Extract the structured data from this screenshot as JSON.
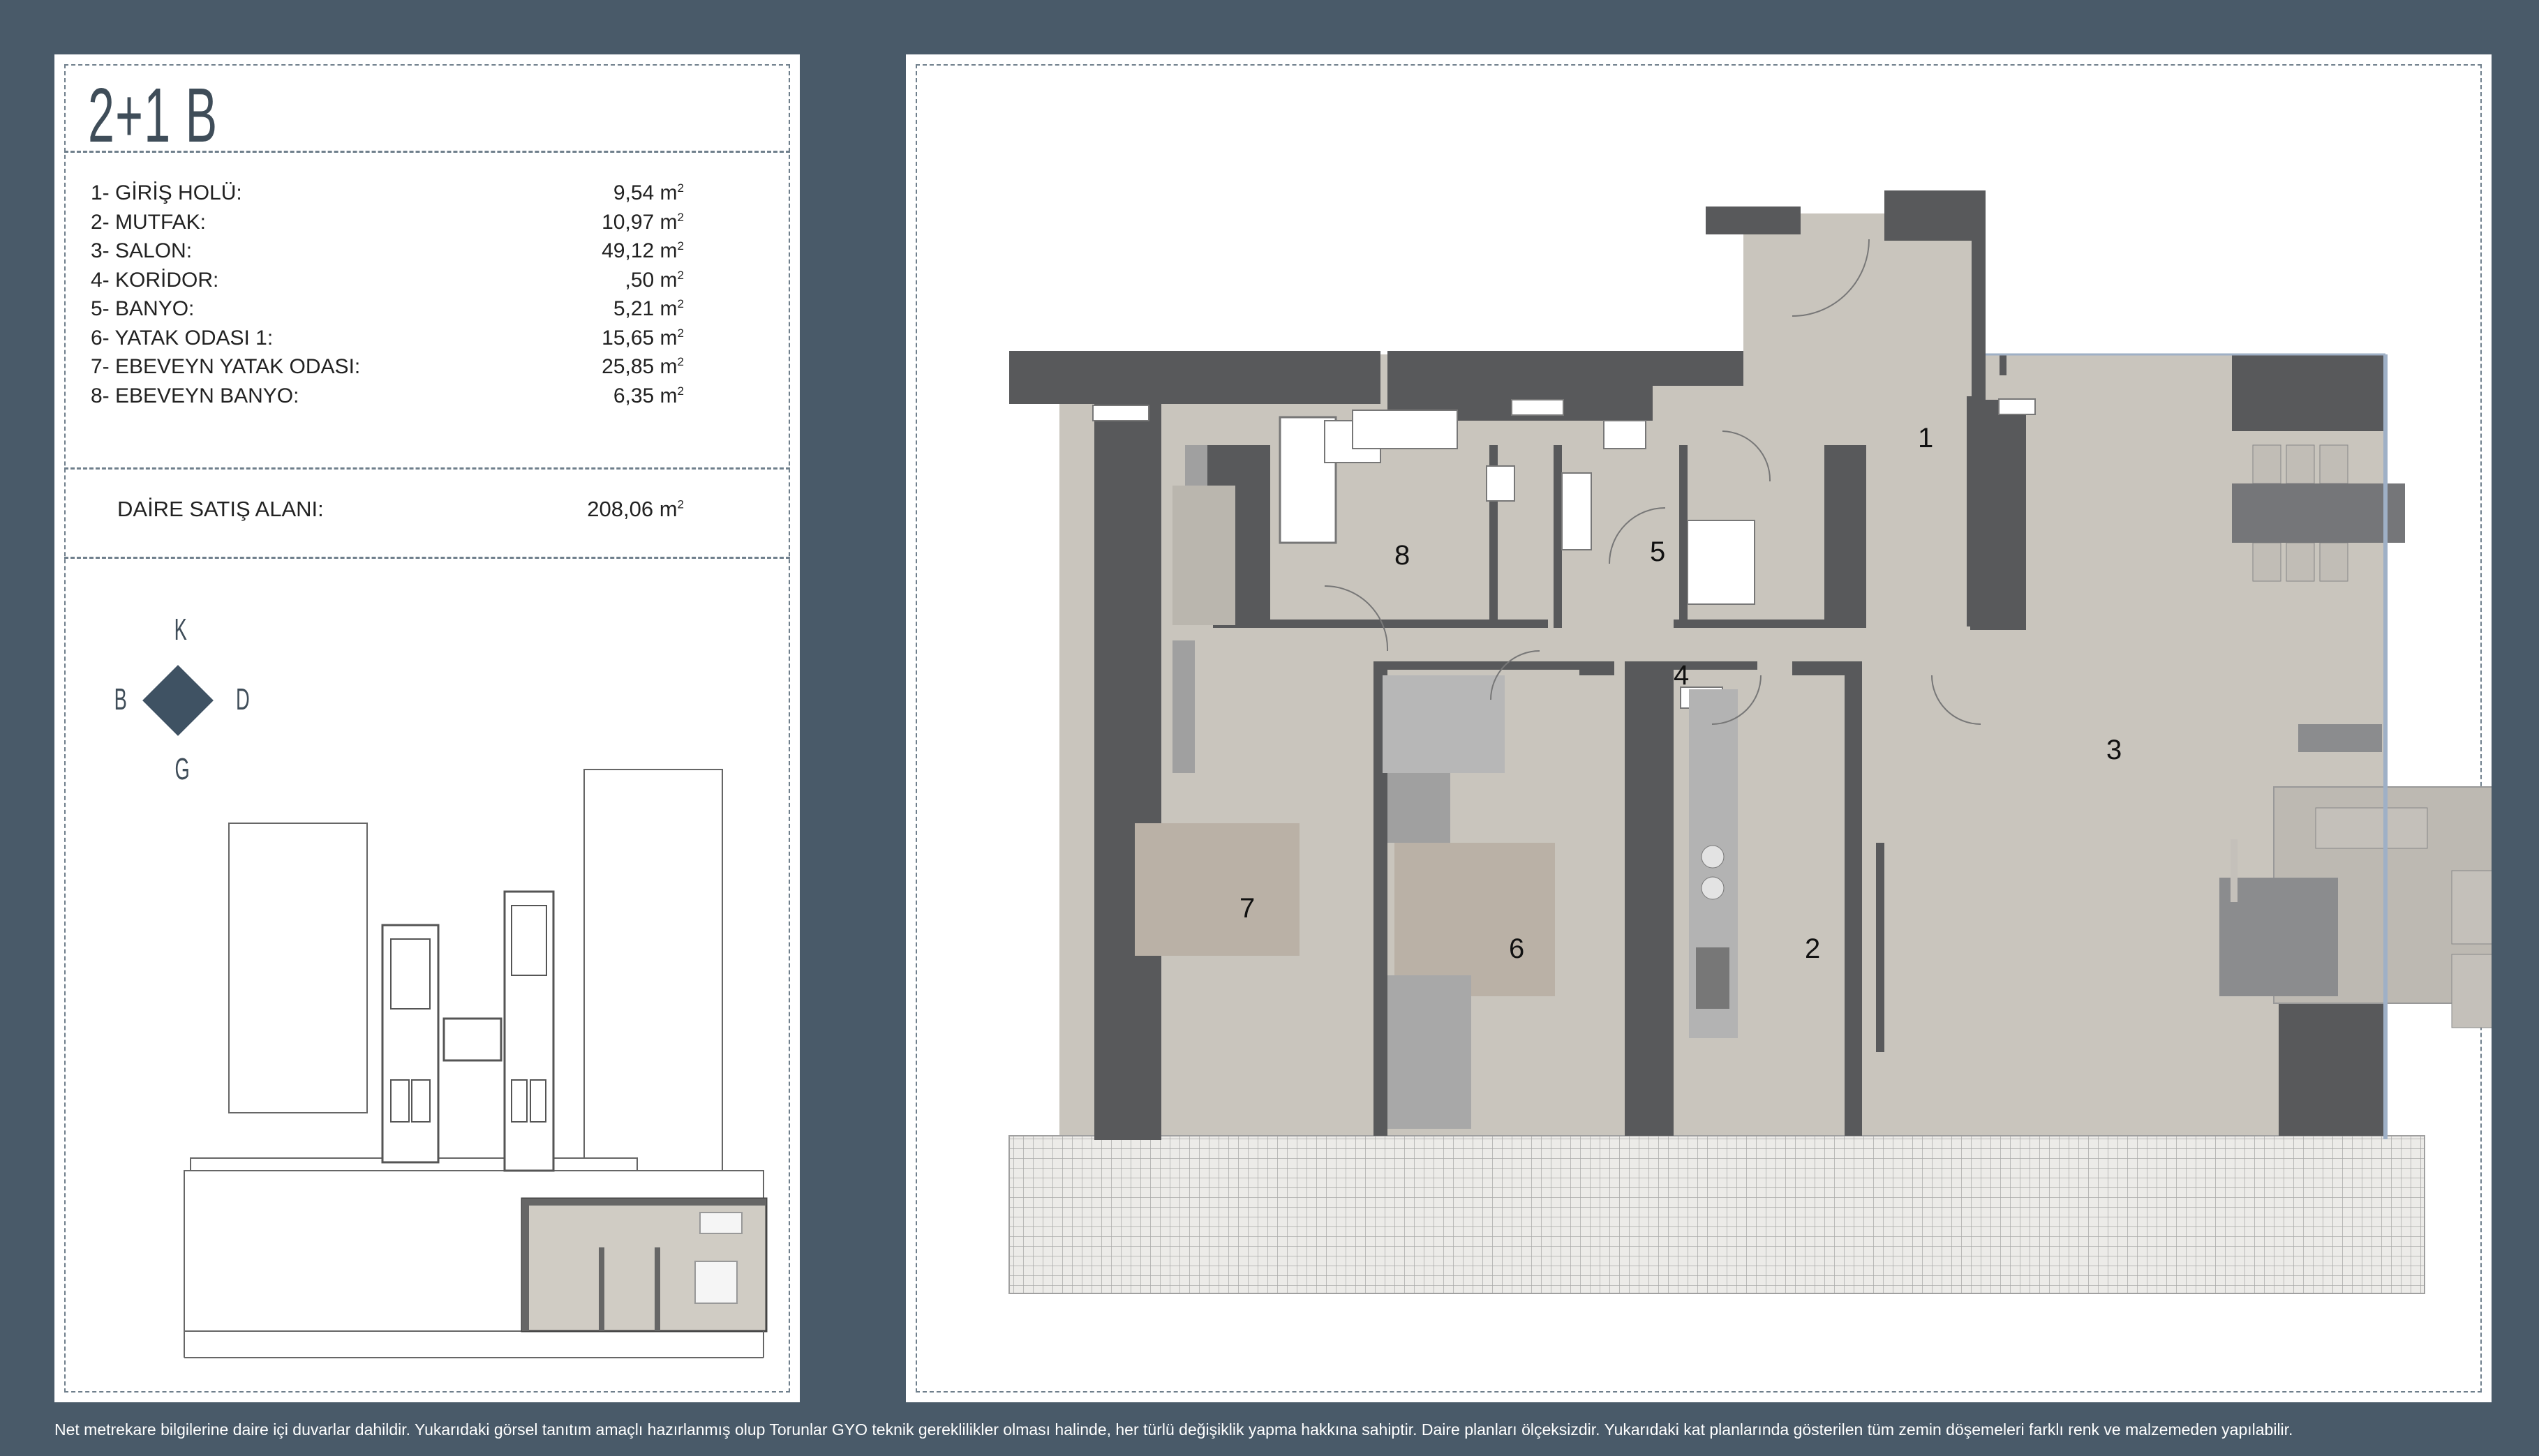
{
  "title": "2+1 B",
  "rooms": [
    {
      "label": "1- GİRİŞ HOLÜ:",
      "area": "9,54 m",
      "unit": "2"
    },
    {
      "label": "2- MUTFAK:",
      "area": "10,97 m",
      "unit": "2"
    },
    {
      "label": "3- SALON:",
      "area": "49,12 m",
      "unit": "2"
    },
    {
      "label": "4- KORİDOR:",
      "area": ",50 m",
      "unit": "2"
    },
    {
      "label": "5- BANYO:",
      "area": "5,21 m",
      "unit": "2"
    },
    {
      "label": "6- YATAK ODASI 1:",
      "area": "15,65 m",
      "unit": "2"
    },
    {
      "label": "7- EBEVEYN YATAK ODASI:",
      "area": "25,85 m",
      "unit": "2"
    },
    {
      "label": "8- EBEVEYN BANYO:",
      "area": "6,35 m",
      "unit": "2"
    }
  ],
  "total": {
    "label": "DAİRE SATIŞ ALANI:",
    "area": "208,06 m",
    "unit": "2"
  },
  "compass": {
    "north": "K",
    "west": "B",
    "east": "D",
    "south": "G"
  },
  "plan_labels": {
    "r1": "1",
    "r2": "2",
    "r3": "3",
    "r4": "4",
    "r5": "5",
    "r6": "6",
    "r7": "7",
    "r8": "8"
  },
  "footnote": "Net metrekare bilgilerine daire içi duvarlar dahildir.  Yukarıdaki görsel tanıtım amaçlı hazırlanmış olup Torunlar GYO teknik gereklilikler olması halinde, her türlü değişiklik yapma hakkına sahiptir. Daire planları ölçeksizdir. Yukarıdaki kat planlarında gösterilen tüm zemin döşemeleri farklı renk ve malzemeden yapılabilir.",
  "colors": {
    "background": "#495a69",
    "wall": "#58595b",
    "floor": "#c9c5bd",
    "accent": "#3f5263"
  }
}
